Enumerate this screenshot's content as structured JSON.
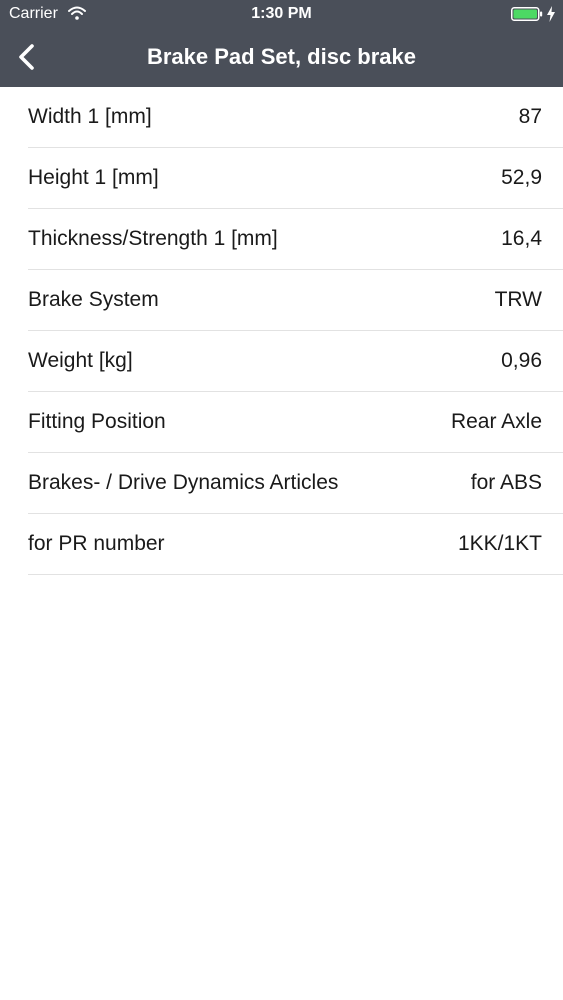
{
  "status_bar": {
    "carrier": "Carrier",
    "time": "1:30 PM",
    "wifi_icon": "wifi-icon",
    "battery_icon": "battery-icon",
    "charging_icon": "bolt-icon",
    "battery_color": "#4cd964"
  },
  "nav": {
    "title": "Brake Pad Set, disc brake",
    "back_icon": "chevron-left-icon",
    "background": "#4a4f59"
  },
  "specs": [
    {
      "label": "Width 1 [mm]",
      "value": "87"
    },
    {
      "label": "Height 1 [mm]",
      "value": "52,9"
    },
    {
      "label": "Thickness/Strength 1 [mm]",
      "value": "16,4"
    },
    {
      "label": "Brake System",
      "value": "TRW"
    },
    {
      "label": "Weight [kg]",
      "value": "0,96"
    },
    {
      "label": "Fitting Position",
      "value": "Rear Axle"
    },
    {
      "label": "Brakes- / Drive Dynamics Articles",
      "value": "for ABS"
    },
    {
      "label": "for PR number",
      "value": "1KK/1KT"
    }
  ]
}
